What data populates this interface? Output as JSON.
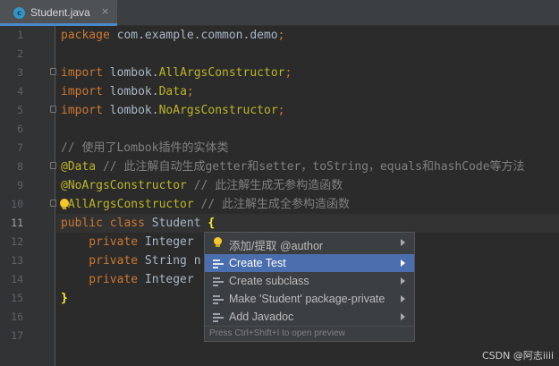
{
  "tab": {
    "title": "Student.java",
    "close": "×",
    "icon_letter": "c"
  },
  "gutter": {
    "line_numbers": [
      "1",
      "2",
      "3",
      "4",
      "5",
      "6",
      "7",
      "8",
      "9",
      "10",
      "11",
      "12",
      "13",
      "14",
      "15",
      "16",
      "17"
    ]
  },
  "code": {
    "l1": {
      "kw": "package",
      "rest": " com.example.common.demo",
      "semi": ";"
    },
    "l3": {
      "kw": "import",
      "pkg": " lombok.",
      "cls": "AllArgsConstructor",
      "semi": ";"
    },
    "l4": {
      "kw": "import",
      "pkg": " lombok.",
      "cls": "Data",
      "semi": ";"
    },
    "l5": {
      "kw": "import",
      "pkg": " lombok.",
      "cls": "NoArgsConstructor",
      "semi": ";"
    },
    "l7": {
      "comment": "// 使用了Lombok插件的实体类"
    },
    "l8": {
      "ann": "@Data",
      "comment": " // 此注解自动生成getter和setter，toString，equals和hashCode等方法"
    },
    "l9": {
      "ann": "@NoArgsConstructor",
      "comment": " // 此注解生成无参构造函数"
    },
    "l10": {
      "ann": "@AllArgsConstructor",
      "comment": " // 此注解生成全参构造函数"
    },
    "l11": {
      "kw": "public class",
      "name": " Student ",
      "brace": "{"
    },
    "l12": {
      "kw": "    private",
      "type": " Integer"
    },
    "l13": {
      "kw": "    private",
      "type": " String n"
    },
    "l14": {
      "kw": "    private",
      "type": " Integer"
    },
    "l15": {
      "brace": "}"
    }
  },
  "popup": {
    "items": [
      {
        "label": "添加/提取 @author"
      },
      {
        "label": "Create Test"
      },
      {
        "label": "Create subclass"
      },
      {
        "label": "Make 'Student' package-private"
      },
      {
        "label": "Add Javadoc"
      }
    ],
    "hint": "Press Ctrl+Shift+I to open preview"
  },
  "watermark": "CSDN @阿志iiii",
  "colors": {
    "selection": "#4b6eaf",
    "keyword": "#cc7832",
    "annotation": "#bbb529",
    "comment": "#808080"
  }
}
